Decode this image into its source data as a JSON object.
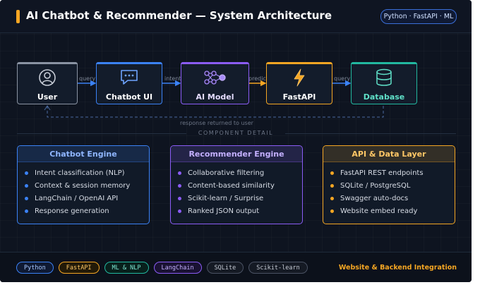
{
  "header": {
    "title": "AI Chatbot & Recommender — System Architecture",
    "stack_badge": "Python · FastAPI · ML"
  },
  "flow": {
    "nodes": [
      {
        "id": "user",
        "label": "User",
        "icon": "user-icon",
        "color": "#8a93a3",
        "text_color": "#ffffff"
      },
      {
        "id": "chatbot-ui",
        "label": "Chatbot UI",
        "icon": "chat-bubble-icon",
        "color": "#3b82f6",
        "text_color": "#ffffff"
      },
      {
        "id": "ai-model",
        "label": "AI Model",
        "icon": "neural-network-icon",
        "color": "#8b5cf6",
        "text_color": "#e4dcff"
      },
      {
        "id": "fastapi",
        "label": "FastAPI",
        "icon": "lightning-bolt-icon",
        "color": "#f5a623",
        "text_color": "#ffffff"
      },
      {
        "id": "database",
        "label": "Database",
        "icon": "database-cylinder-icon",
        "color": "#22b8a0",
        "text_color": "#5fe0c8"
      }
    ],
    "edges": [
      "query",
      "intent",
      "predict",
      "query"
    ],
    "return_label": "response returned to user"
  },
  "section_title": "COMPONENT DETAIL",
  "cards": [
    {
      "title": "Chatbot Engine",
      "color": "#3b82f6",
      "title_color": "#8fb6ff",
      "items": [
        "Intent classification (NLP)",
        "Context & session memory",
        "LangChain / OpenAI API",
        "Response generation"
      ]
    },
    {
      "title": "Recommender Engine",
      "color": "#8b5cf6",
      "title_color": "#c4b0ff",
      "items": [
        "Collaborative filtering",
        "Content-based similarity",
        "Scikit-learn / Surprise",
        "Ranked JSON output"
      ]
    },
    {
      "title": "API & Data Layer",
      "color": "#f5a623",
      "title_color": "#ffc766",
      "items": [
        "FastAPI REST endpoints",
        "SQLite / PostgreSQL",
        "Swagger auto-docs",
        "Website embed ready"
      ]
    }
  ],
  "footer": {
    "chips": [
      {
        "label": "Python",
        "border": "#3b82f6",
        "text": "#a8c8ff",
        "bg": "#0f1a33"
      },
      {
        "label": "FastAPI",
        "border": "#f5a623",
        "text": "#ffc766",
        "bg": "#231a08"
      },
      {
        "label": "ML & NLP",
        "border": "#22b8a0",
        "text": "#7ee8d3",
        "bg": "#08201c"
      },
      {
        "label": "LangChain",
        "border": "#8b5cf6",
        "text": "#c4b0ff",
        "bg": "#1a1233"
      },
      {
        "label": "SQLite",
        "border": "#4a5263",
        "text": "#c4c9d3",
        "bg": "#151a24"
      },
      {
        "label": "Scikit-learn",
        "border": "#4a5263",
        "text": "#c4c9d3",
        "bg": "#151a24"
      }
    ],
    "note": "Website & Backend Integration"
  }
}
